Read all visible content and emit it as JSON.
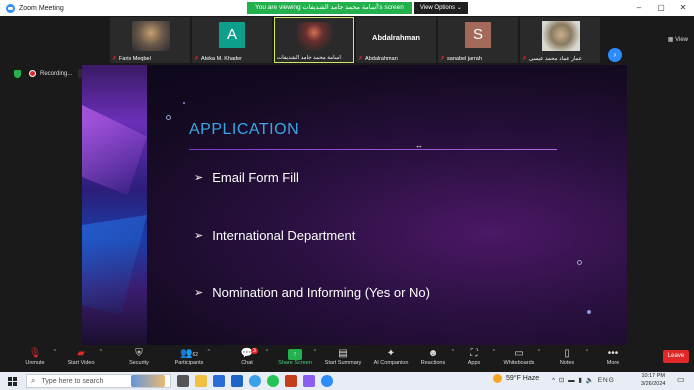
{
  "window": {
    "title": "Zoom Meeting",
    "controls": [
      "–",
      "▢",
      "✕"
    ]
  },
  "banner": {
    "viewing": "You are viewing أسامة محمد جامد الشديفات's screen",
    "view_options": "View Options ⌄"
  },
  "participants": [
    {
      "name": "Faris Meqbel",
      "type": "photo",
      "color": "#6b5a4a"
    },
    {
      "name": "Ateka M. Khader",
      "type": "letter",
      "letter": "A",
      "color": "#0e9e8c"
    },
    {
      "name": "اسامة محمد جامد الشديفات",
      "type": "photo",
      "color": "#4a3030",
      "active": true
    },
    {
      "name": "Abdalrahman",
      "type": "text",
      "label": "Abdalrahman",
      "color": "#2a2a2a"
    },
    {
      "name": "sanabel jarrah",
      "type": "letter",
      "letter": "S",
      "color": "#a36a5a"
    },
    {
      "name": "عمار عماد محمد عيسى",
      "type": "photo",
      "color": "#9a8a70"
    }
  ],
  "strip": {
    "next": "›",
    "view": "▦ View"
  },
  "recording": {
    "label": "Recording...",
    "pause": "❚❚",
    "stop": "■"
  },
  "slide": {
    "title": "APPLICATION",
    "cursor": "↔",
    "bullets": [
      "Email Form Fill",
      "International Department",
      "Nomination and Informing (Yes or No)"
    ],
    "arrow": "➢"
  },
  "toolbar": {
    "unmute": "Unmute",
    "start_video": "Start Video",
    "security": "Security",
    "participants": "Participants",
    "participants_count": "62",
    "chat": "Chat",
    "chat_badge": "3",
    "share_screen": "Share Screen",
    "start_summary": "Start Summary",
    "ai_companion": "AI Companion",
    "reactions": "Reactions",
    "apps": "Apps",
    "whiteboards": "Whiteboards",
    "notes": "Notes",
    "more": "More",
    "leave": "Leave"
  },
  "taskbar": {
    "search_placeholder": "Type here to search",
    "weather": "59°F  Haze",
    "tray": "^ ⊡ ▬ ▮ 🔈 ENG",
    "time": "10:17 PM",
    "date": "3/26/2024",
    "notifications": "▭"
  }
}
